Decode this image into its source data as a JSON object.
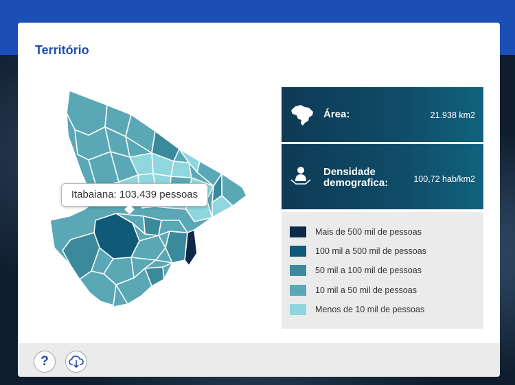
{
  "title": "Território",
  "tooltip": {
    "text": "Itabaiana: 103.439 pessoas"
  },
  "info": {
    "area": {
      "icon": "brazil-map-icon",
      "label": "Área:",
      "value": "21.938 km2"
    },
    "density": {
      "icon": "population-icon",
      "label_line1": "Densidade",
      "label_line2": "demografica:",
      "value": "100,72 hab/km2"
    }
  },
  "legend": [
    {
      "label": "Mais de 500 mil de pessoas",
      "color": "#0d2a48"
    },
    {
      "label": "100 mil a 500 mil de pessoas",
      "color": "#0f5a78"
    },
    {
      "label": "50 mil a 100 mil de pessoas",
      "color": "#3a8a9c"
    },
    {
      "label": "10 mil a 50 mil de pessoas",
      "color": "#5aa7b6"
    },
    {
      "label": "Menos de 10 mil de pessoas",
      "color": "#8fd6de"
    }
  ],
  "footer": {
    "help_label": "?",
    "help_icon": "question-icon",
    "download_icon": "cloud-download-icon"
  },
  "colors": {
    "accent": "#1d4ea6",
    "top_bar": "#1b4fb5",
    "info_bg": "#0f4a66"
  }
}
